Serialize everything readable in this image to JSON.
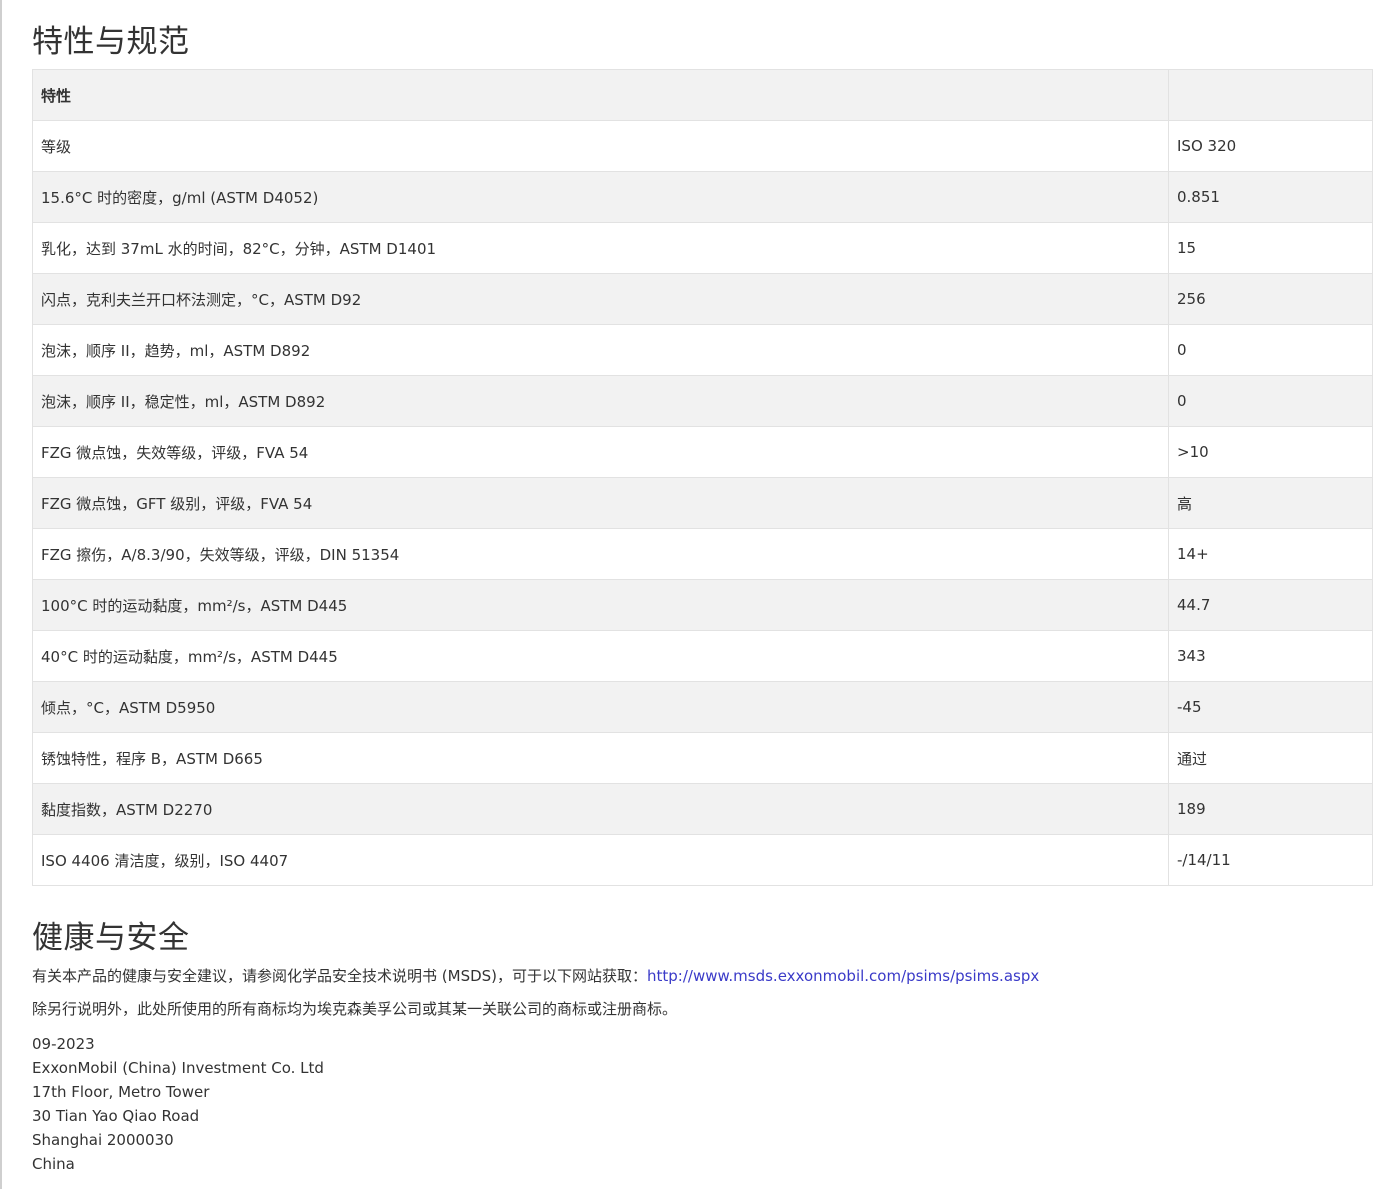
{
  "specs": {
    "title": "特性与规范",
    "header": {
      "property": "特性",
      "value": ""
    },
    "rows": [
      {
        "property": "等级",
        "value": "ISO 320"
      },
      {
        "property": "15.6°C 时的密度，g/ml (ASTM D4052)",
        "value": "0.851"
      },
      {
        "property": "乳化，达到 37mL 水的时间，82°C，分钟，ASTM D1401",
        "value": "15"
      },
      {
        "property": "闪点，克利夫兰开口杯法测定，°C，ASTM D92",
        "value": "256"
      },
      {
        "property": "泡沫，顺序 II，趋势，ml，ASTM D892",
        "value": "0"
      },
      {
        "property": "泡沫，顺序 II，稳定性，ml，ASTM D892",
        "value": "0"
      },
      {
        "property": "FZG 微点蚀，失效等级，评级，FVA 54",
        "value": ">10"
      },
      {
        "property": "FZG 微点蚀，GFT 级别，评级，FVA 54",
        "value": "高"
      },
      {
        "property": "FZG 擦伤，A/8.3/90，失效等级，评级，DIN 51354",
        "value": "14+"
      },
      {
        "property": "100°C 时的运动黏度，mm²/s，ASTM D445",
        "value": "44.7"
      },
      {
        "property": "40°C 时的运动黏度，mm²/s，ASTM D445",
        "value": "343"
      },
      {
        "property": "倾点，°C，ASTM D5950",
        "value": "-45"
      },
      {
        "property": "锈蚀特性，程序 B，ASTM D665",
        "value": "通过"
      },
      {
        "property": "黏度指数，ASTM D2270",
        "value": "189"
      },
      {
        "property": "ISO 4406 清洁度，级别，ISO 4407",
        "value": "-/14/11"
      }
    ]
  },
  "safety": {
    "title": "健康与安全",
    "msds_text": "有关本产品的健康与安全建议，请参阅化学品安全技术说明书 (MSDS)，可于以下网站获取：",
    "msds_link": "http://www.msds.exxonmobil.com/psims/psims.aspx",
    "trademark_text": "除另行说明外，此处所使用的所有商标均为埃克森美孚公司或其某一关联公司的商标或注册商标。"
  },
  "footer": {
    "date": "09-2023",
    "address_lines": [
      "ExxonMobil (China) Investment Co. Ltd",
      "17th Floor, Metro Tower",
      "30 Tian Yao Qiao Road",
      "Shanghai 2000030",
      "China"
    ]
  },
  "colors": {
    "text": "#333333",
    "link": "#3a3ac8",
    "row_alt": "#f2f2f2",
    "border": "#e2e2e2"
  }
}
